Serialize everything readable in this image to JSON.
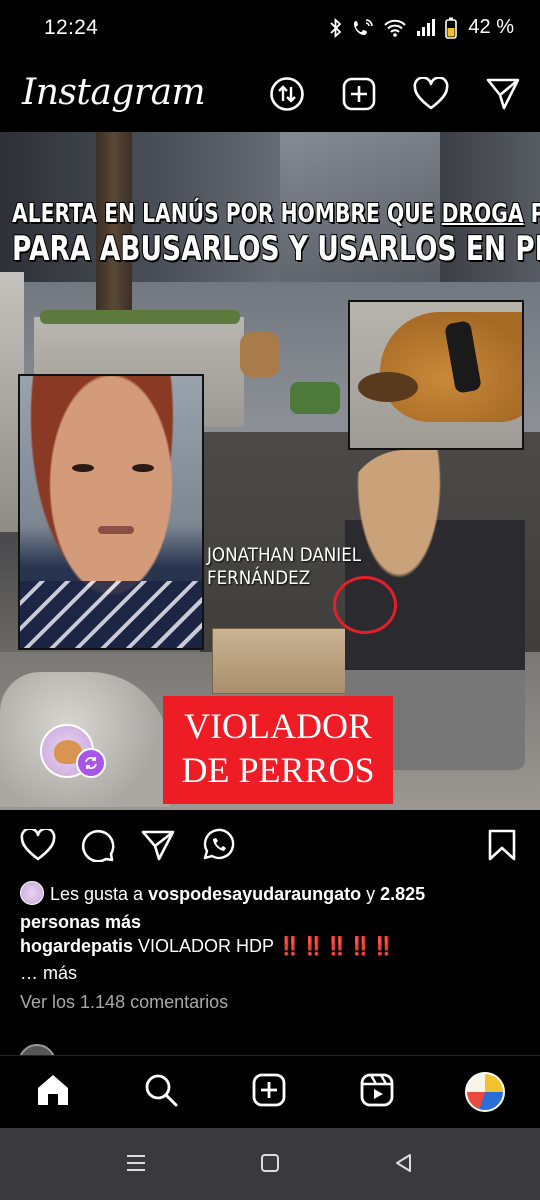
{
  "status_bar": {
    "time": "12:24",
    "battery": "42 %"
  },
  "header": {
    "logo": "Instagram"
  },
  "post": {
    "headline_line1_a": "ALERTA EN LANÚS POR HOMBRE QUE ",
    "headline_line1_b": "DROGA",
    "headline_line1_c": " PERROS",
    "headline_line2": "PARA ABUSARLOS Y USARLOS EN PELEAS",
    "name_line1": "JONATHAN DANIEL",
    "name_line2": "FERNÁNDEZ",
    "banner_line1": "VIOLADOR",
    "banner_line2": "DE PERROS"
  },
  "likes": {
    "prefix": "Les gusta a ",
    "user": "vospodesayudaraungato",
    "connector": " y ",
    "count": "2.825",
    "suffix": "personas más"
  },
  "caption": {
    "username": "hogardepatis",
    "text": " VIOLADOR HDP ",
    "emphasis": "‼️‼️‼️‼️‼️",
    "more": "… más"
  },
  "comments": {
    "link": "Ver los 1.148 comentarios"
  },
  "icons": {
    "header": [
      "threads-icon",
      "add-post-icon",
      "heart-icon",
      "direct-message-icon"
    ],
    "actions": [
      "like-icon",
      "comment-icon",
      "share-icon",
      "whatsapp-icon",
      "save-icon"
    ],
    "nav": [
      "home-icon",
      "search-icon",
      "create-icon",
      "reels-icon",
      "profile-avatar"
    ]
  },
  "colors": {
    "accent_red": "#ee1c25",
    "repost_purple": "#a855e8",
    "muted_text": "#a8a8a8"
  }
}
